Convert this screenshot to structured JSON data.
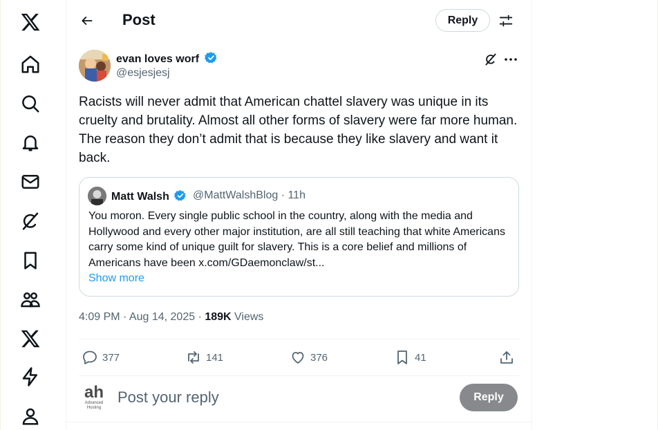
{
  "header": {
    "title": "Post",
    "reply_pill": "Reply"
  },
  "nav": {
    "items": [
      "x-logo-icon",
      "home-icon",
      "explore-icon",
      "notifications-icon",
      "messages-icon",
      "grok-icon",
      "bookmarks-icon",
      "communities-icon",
      "premium-icon",
      "verified-orgs-icon",
      "profile-icon"
    ]
  },
  "post": {
    "author_name": "evan loves worf",
    "author_handle": "@esjesjesj",
    "text": "Racists will never admit that American chattel slavery was unique in its cruelty and brutality. Almost all other forms of slavery were far more human. The reason they don’t admit that is because they like slavery and want it back.",
    "quote": {
      "name": "Matt Walsh",
      "meta": "@MattWalshBlog · 11h",
      "text": "You moron. Every single public school in the country, along with the media and Hollywood and every other major institution, are all still teaching that white Americans carry some kind of unique guilt for slavery. This is a core belief and millions of Americans have been x.com/GDaemonclaw/st...",
      "show_more": "Show more"
    },
    "timestamp": "4:09 PM · Aug 14, 2025 · ",
    "views_count": "189K",
    "views_label": " Views",
    "actions": {
      "replies": "377",
      "reposts": "141",
      "likes": "376",
      "bookmarks": "41"
    }
  },
  "composer": {
    "avatar_brand": "ah",
    "avatar_caption_1": "Advanced",
    "avatar_caption_2": "Hosting",
    "placeholder": "Post your reply",
    "button": "Reply"
  },
  "colors": {
    "accent": "#1d9bf0",
    "muted_text": "#536471",
    "border": "#cfd9de",
    "disabled_button": "#87898c"
  }
}
